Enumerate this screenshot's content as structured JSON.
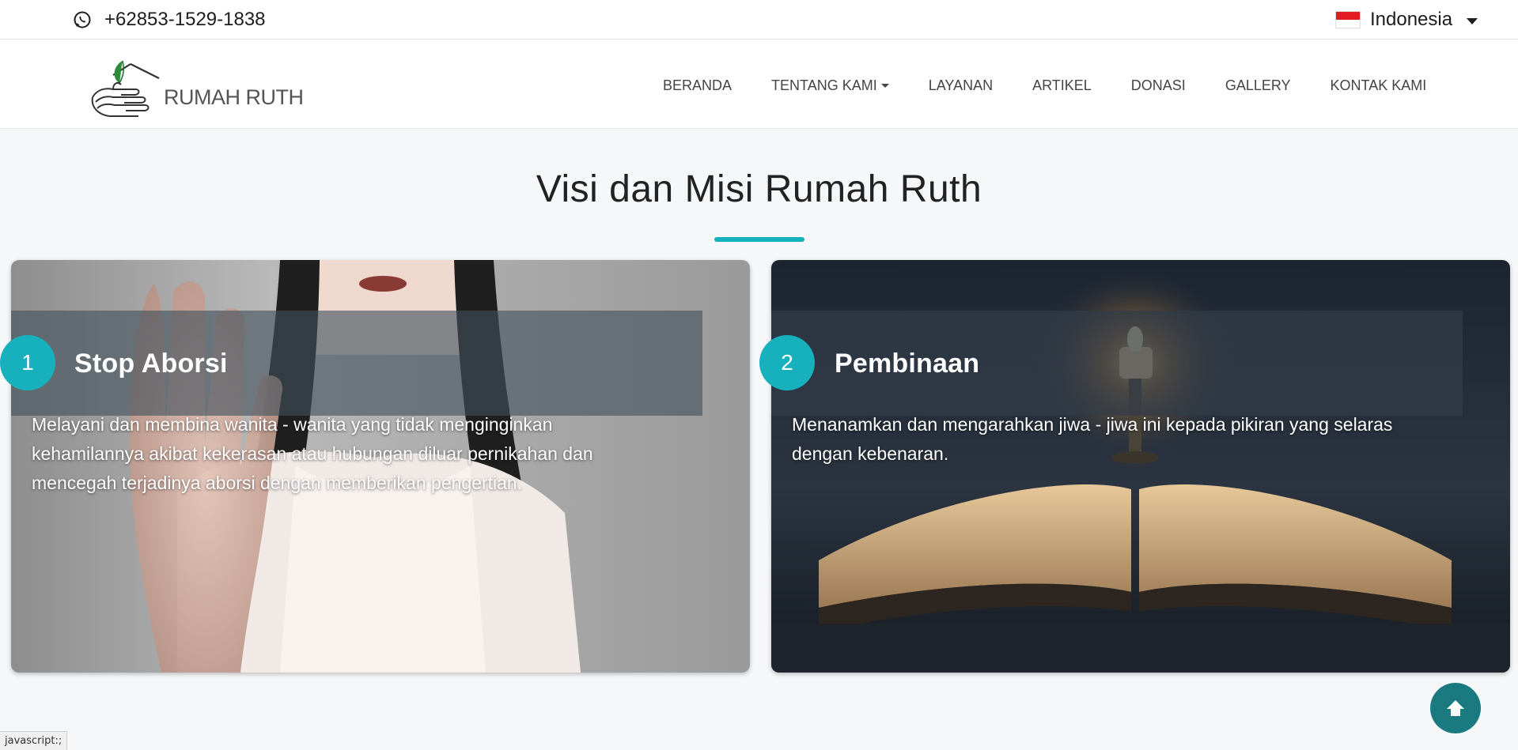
{
  "topbar": {
    "phone": "+62853-1529-1838",
    "language": "Indonesia"
  },
  "navbar": {
    "logo_text": "RUMAH RUTH",
    "links": [
      "BERANDA",
      "TENTANG KAMI",
      "LAYANAN",
      "ARTIKEL",
      "DONASI",
      "GALLERY",
      "KONTAK KAMI"
    ]
  },
  "section": {
    "title": "Visi dan Misi Rumah Ruth",
    "accent_color": "#17b0bd",
    "cards": [
      {
        "number": "1",
        "heading": "Stop Aborsi",
        "text": "Melayani dan membina wanita - wanita yang tidak menginginkan kehamilannya akibat kekerasan atau hubungan diluar pernikahan dan mencegah terjadinya aborsi dengan memberikan pengertian."
      },
      {
        "number": "2",
        "heading": "Pembinaan",
        "text": "Menanamkan dan mengarahkan jiwa - jiwa ini kepada pikiran yang selaras dengan kebenaran."
      }
    ]
  },
  "icons": {
    "phone": "whatsapp-icon",
    "language": "indonesia-flag-icon",
    "scroll_top": "arrow-up-icon"
  },
  "status_bar": "javascript:;"
}
